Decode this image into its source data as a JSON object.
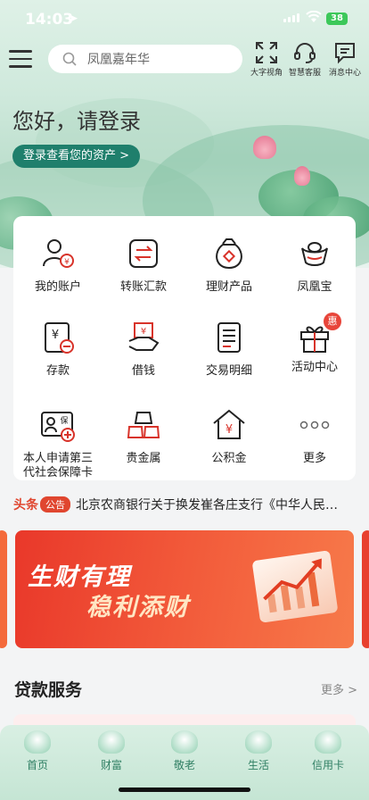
{
  "status": {
    "time": "14:03",
    "battery": "38"
  },
  "header": {
    "search_placeholder": "凤凰嘉年华",
    "buttons": [
      {
        "label": "大字视角",
        "icon": "expand-icon"
      },
      {
        "label": "智慧客服",
        "icon": "headset-icon"
      },
      {
        "label": "消息中心",
        "icon": "message-icon"
      }
    ]
  },
  "hero": {
    "greeting": "您好，请登录",
    "login_button": "登录查看您的资产 >"
  },
  "grid": [
    {
      "label": "我的账户",
      "icon": "account-icon"
    },
    {
      "label": "转账汇款",
      "icon": "transfer-icon"
    },
    {
      "label": "理财产品",
      "icon": "money-bag-icon"
    },
    {
      "label": "凤凰宝",
      "icon": "ingot-icon"
    },
    {
      "label": "存款",
      "icon": "deposit-icon"
    },
    {
      "label": "借钱",
      "icon": "borrow-icon"
    },
    {
      "label": "交易明细",
      "icon": "receipt-icon"
    },
    {
      "label": "活动中心",
      "icon": "gift-icon",
      "badge": "惠"
    },
    {
      "label": "本人申请第三代社会保障卡",
      "label_line1": "本人申请第三",
      "label_line2": "代社会保障卡",
      "icon": "social-card-icon"
    },
    {
      "label": "贵金属",
      "icon": "gold-bars-icon"
    },
    {
      "label": "公积金",
      "icon": "house-fund-icon"
    },
    {
      "label": "更多",
      "icon": "more-dots-icon"
    }
  ],
  "ticker": {
    "head": "头条",
    "tag": "公告",
    "text": "北京农商银行关于换发崔各庄支行《中华人民…"
  },
  "banner": {
    "line1": "生财有理",
    "line2": "稳利添财"
  },
  "loans": {
    "title": "贷款服务",
    "more": "更多 >"
  },
  "tabs": [
    {
      "label": "首页"
    },
    {
      "label": "财富"
    },
    {
      "label": "敬老"
    },
    {
      "label": "生活"
    },
    {
      "label": "信用卡"
    }
  ],
  "colors": {
    "accent": "#1f7f6c",
    "red": "#e0462f"
  }
}
